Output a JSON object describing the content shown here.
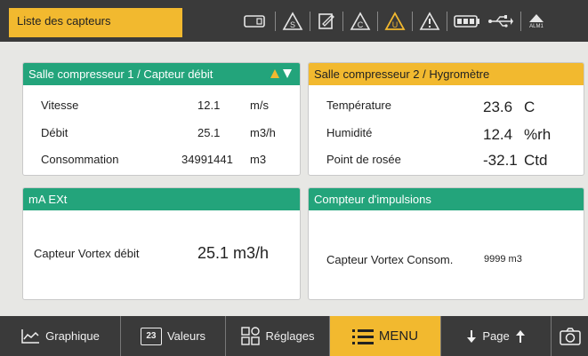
{
  "header": {
    "title": "Liste des capteurs",
    "status_icons": [
      "sd-card-icon",
      "warning-s-icon",
      "edit-note-icon",
      "warning-c-icon",
      "warning-u-icon",
      "warning-icon",
      "battery-icon",
      "usb-icon",
      "alarm-icon"
    ],
    "alarm_label": "ALM1"
  },
  "panels": {
    "p1": {
      "title": "Salle compresseur 1 / Capteur débit",
      "rows": [
        {
          "label": "Vitesse",
          "value": "12.1",
          "unit": "m/s"
        },
        {
          "label": "Débit",
          "value": "25.1",
          "unit": "m3/h"
        },
        {
          "label": "Consommation",
          "value": "34991441",
          "unit": "m3"
        }
      ]
    },
    "p2": {
      "title": "Salle compresseur 2 / Hygromètre",
      "rows": [
        {
          "label": "Température",
          "value": "23.6",
          "unit": "C"
        },
        {
          "label": "Humidité",
          "value": "12.4",
          "unit": "%rh"
        },
        {
          "label": "Point de rosée",
          "value": "-32.1",
          "unit": "Ctd"
        }
      ]
    },
    "p3": {
      "title": "mA EXt",
      "label": "Capteur Vortex débit",
      "value": "25.1 m3/h"
    },
    "p4": {
      "title": "Compteur d'impulsions",
      "label": "Capteur Vortex Consom.",
      "value": "9999 m3"
    }
  },
  "footer": {
    "graph": "Graphique",
    "values": "Valeurs",
    "values_badge": "23",
    "settings": "Réglages",
    "menu": "MENU",
    "page": "Page"
  },
  "colors": {
    "accent_yellow": "#f2b92f",
    "accent_green": "#23a47b",
    "bar_dark": "#3a3a3a"
  }
}
